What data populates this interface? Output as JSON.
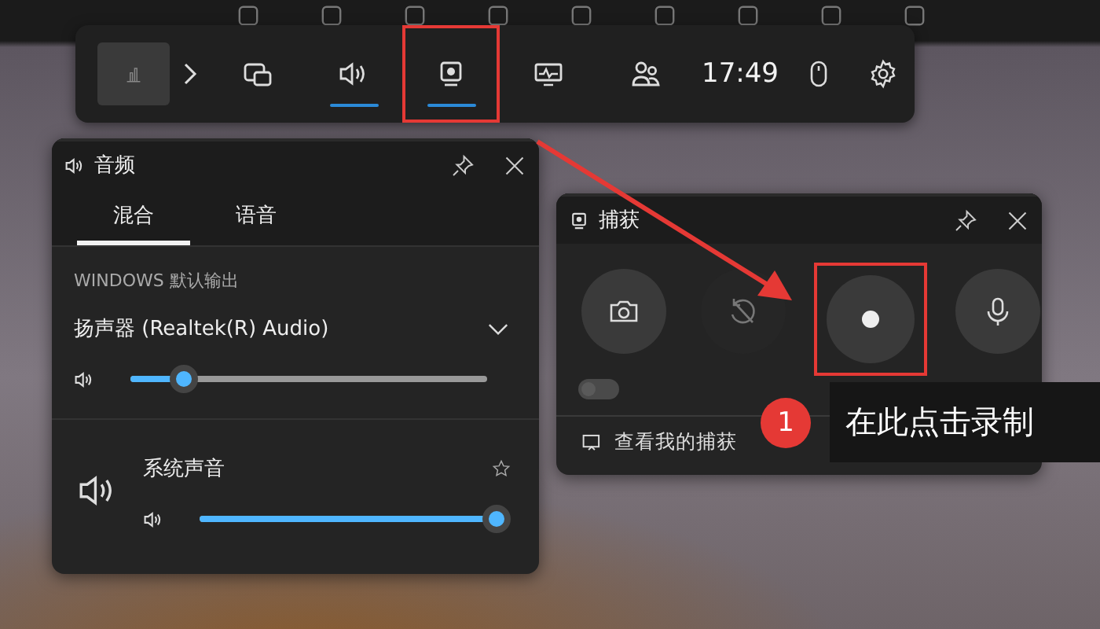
{
  "game_bar": {
    "widgets": [
      {
        "kind": "thumbnail",
        "selected": false,
        "highlighted": false
      },
      {
        "kind": "chevron",
        "selected": false,
        "highlighted": false
      },
      {
        "kind": "widgets",
        "selected": false,
        "highlighted": false
      },
      {
        "kind": "audio",
        "selected": true,
        "highlighted": false
      },
      {
        "kind": "capture",
        "selected": true,
        "highlighted": true
      },
      {
        "kind": "performance",
        "selected": false,
        "highlighted": false
      },
      {
        "kind": "social",
        "selected": false,
        "highlighted": false
      }
    ],
    "time": "17:49",
    "tools": [
      {
        "kind": "mouse"
      },
      {
        "kind": "settings"
      }
    ]
  },
  "audio_widget": {
    "title": "音频",
    "tabs": [
      {
        "label": "混合",
        "selected": true
      },
      {
        "label": "语音",
        "selected": false
      }
    ],
    "section_label": "WINDOWS 默认输出",
    "device": "扬声器 (Realtek(R) Audio)",
    "master": {
      "level": 0.15
    },
    "apps": [
      {
        "name": "系统声音",
        "level": 1.0
      }
    ]
  },
  "capture_widget": {
    "title": "捕获",
    "buttons": [
      {
        "kind": "screenshot",
        "disabled": false,
        "highlighted": false
      },
      {
        "kind": "record-last",
        "disabled": true,
        "highlighted": false
      },
      {
        "kind": "record",
        "disabled": false,
        "highlighted": true
      },
      {
        "kind": "microphone",
        "disabled": false,
        "highlighted": false
      }
    ],
    "toggle": {
      "on": false
    },
    "footer": "查看我的捕获"
  },
  "annotation": {
    "step": "1",
    "text": "在此点击录制"
  }
}
